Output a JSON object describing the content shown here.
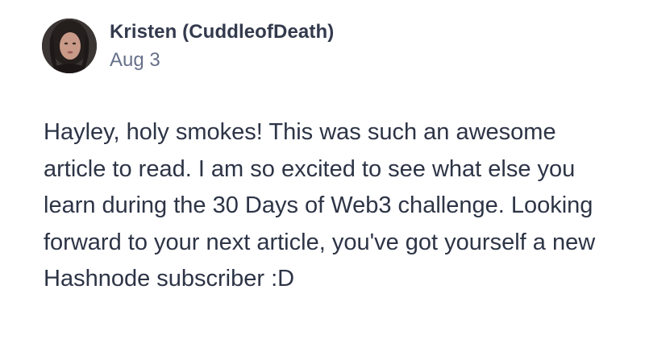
{
  "comment": {
    "author": {
      "name": "Kristen (CuddleofDeath)",
      "avatar_icon": "user-avatar-photo"
    },
    "date": "Aug 3",
    "body": "Hayley, holy smokes! This was such an awesome article to read. I am so excited to see what else you learn during the 30 Days of Web3 challenge. Looking forward to your next article, you've got yourself a new Hashnode subscriber :D"
  },
  "colors": {
    "text": "#2d3446",
    "author": "#333a4d",
    "muted": "#667089",
    "background": "#ffffff"
  }
}
